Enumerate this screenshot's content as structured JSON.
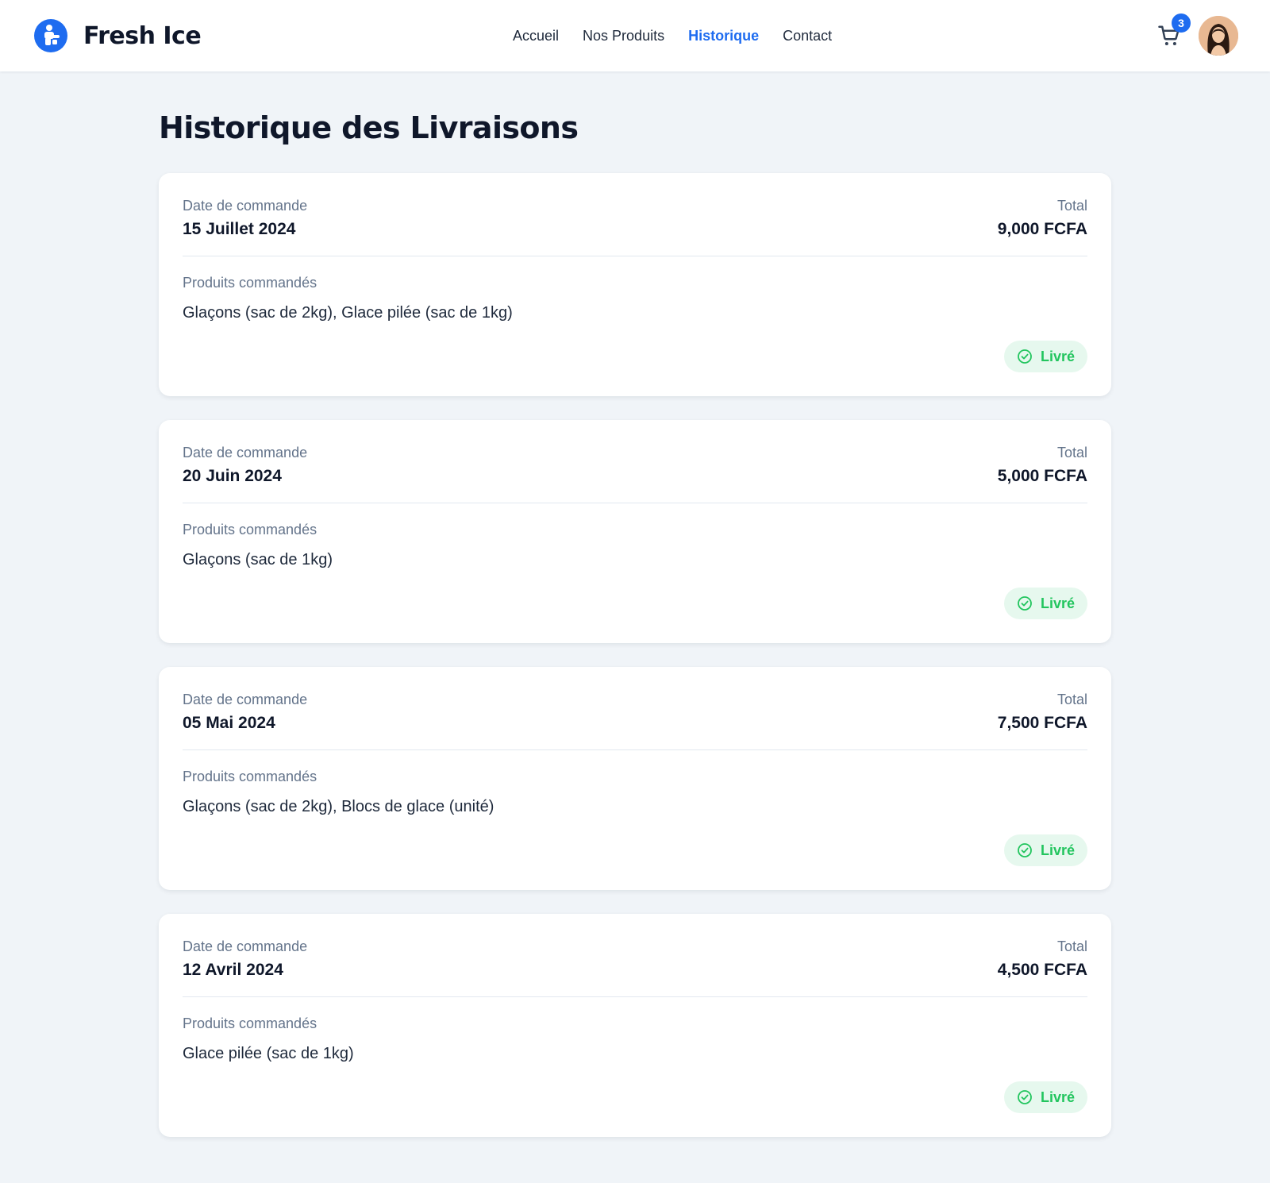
{
  "header": {
    "brand": "Fresh Ice",
    "nav": [
      {
        "label": "Accueil",
        "active": false
      },
      {
        "label": "Nos Produits",
        "active": false
      },
      {
        "label": "Historique",
        "active": true
      },
      {
        "label": "Contact",
        "active": false
      }
    ],
    "cart_count": "3"
  },
  "page": {
    "title": "Historique des Livraisons"
  },
  "labels": {
    "date": "Date de commande",
    "total": "Total",
    "products": "Produits commandés"
  },
  "orders": [
    {
      "date": "15 Juillet 2024",
      "total": "9,000 FCFA",
      "products": "Glaçons (sac de 2kg), Glace pilée (sac de 1kg)",
      "status": "Livré"
    },
    {
      "date": "20 Juin 2024",
      "total": "5,000 FCFA",
      "products": "Glaçons (sac de 1kg)",
      "status": "Livré"
    },
    {
      "date": "05 Mai 2024",
      "total": "7,500 FCFA",
      "products": "Glaçons (sac de 2kg), Blocs de glace (unité)",
      "status": "Livré"
    },
    {
      "date": "12 Avril 2024",
      "total": "4,500 FCFA",
      "products": "Glace pilée (sac de 1kg)",
      "status": "Livré"
    }
  ],
  "colors": {
    "accent": "#1e6cf0",
    "background": "#f0f4f8",
    "status_green": "#22c55e",
    "status_bg": "#e6f8ee"
  },
  "icons": {
    "logo": "ice-person-icon",
    "cart": "shopping-cart-icon",
    "status": "check-circle-icon"
  }
}
